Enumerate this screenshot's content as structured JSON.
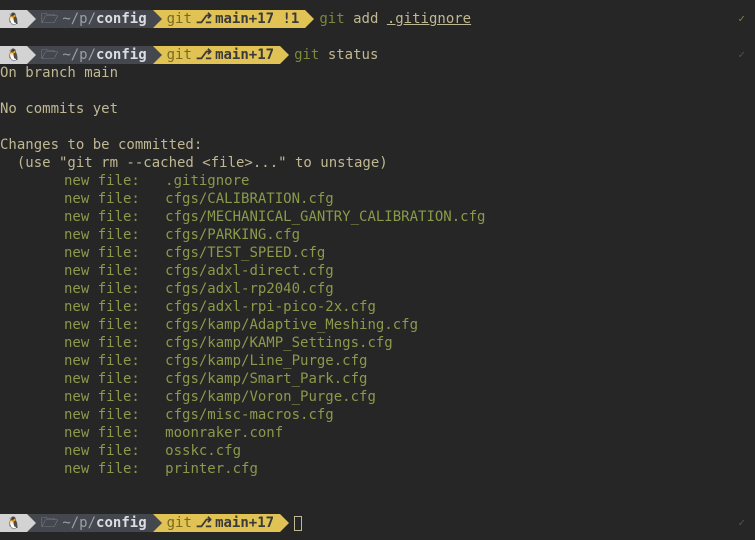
{
  "prompts": [
    {
      "os_icon": "🐧",
      "path_icon": "🗁",
      "path_prefix": "~/p/",
      "path_last": "config",
      "git_label": "git",
      "branch_icon": "⎇",
      "branch": "main",
      "counters": "+17 !1",
      "command": {
        "bin": "git",
        "sub": "add",
        "arg": ".gitignore",
        "arg_underline": true
      },
      "status_check": "✓",
      "status_ok": true
    },
    {
      "os_icon": "🐧",
      "path_icon": "🗁",
      "path_prefix": "~/p/",
      "path_last": "config",
      "git_label": "git",
      "branch_icon": "⎇",
      "branch": "main",
      "counters": "+17",
      "command": {
        "bin": "git",
        "sub": "status",
        "arg": "",
        "arg_underline": false
      },
      "status_check": "✓",
      "status_ok": false
    },
    {
      "os_icon": "🐧",
      "path_icon": "🗁",
      "path_prefix": "~/p/",
      "path_last": "config",
      "git_label": "git",
      "branch_icon": "⎇",
      "branch": "main",
      "counters": "+17",
      "command": null,
      "cursor": true,
      "status_check": "✓",
      "status_ok": false
    }
  ],
  "status_output": {
    "branch_line": "On branch main",
    "no_commits": "No commits yet",
    "changes_header": "Changes to be committed:",
    "unstage_hint": "  (use \"git rm --cached <file>...\" to unstage)",
    "label_newfile": "new file:   ",
    "files": [
      ".gitignore",
      "cfgs/CALIBRATION.cfg",
      "cfgs/MECHANICAL_GANTRY_CALIBRATION.cfg",
      "cfgs/PARKING.cfg",
      "cfgs/TEST_SPEED.cfg",
      "cfgs/adxl-direct.cfg",
      "cfgs/adxl-rp2040.cfg",
      "cfgs/adxl-rpi-pico-2x.cfg",
      "cfgs/kamp/Adaptive_Meshing.cfg",
      "cfgs/kamp/KAMP_Settings.cfg",
      "cfgs/kamp/Line_Purge.cfg",
      "cfgs/kamp/Smart_Park.cfg",
      "cfgs/kamp/Voron_Purge.cfg",
      "cfgs/misc-macros.cfg",
      "moonraker.conf",
      "osskc.cfg",
      "printer.cfg"
    ]
  }
}
